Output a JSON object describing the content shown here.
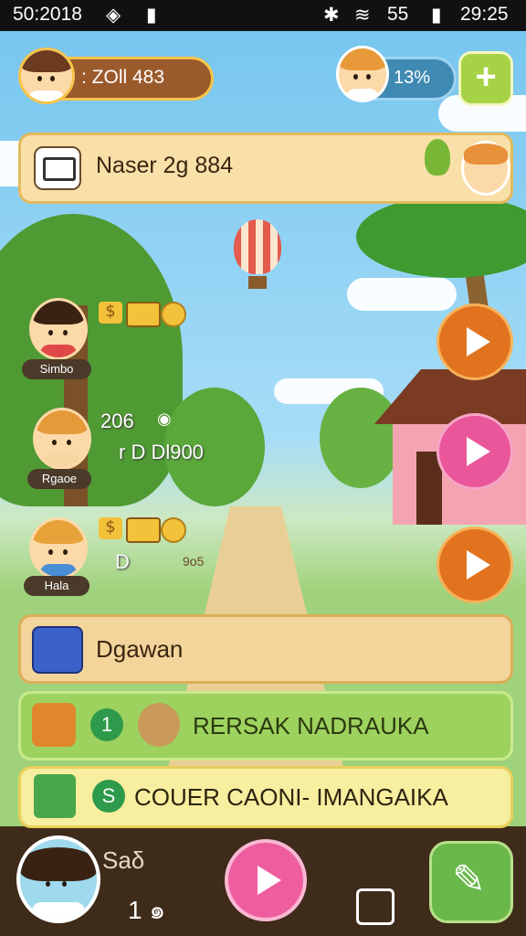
{
  "status_bar": {
    "time_left": "50:2018",
    "signal": "55",
    "time_right": "29:25"
  },
  "hud": {
    "currency_value": ": ZOll 483",
    "percent": "13%",
    "add_label": "+",
    "banner_text": "Naser 2g 884"
  },
  "characters": [
    {
      "name": "Simbo",
      "stat_main": "",
      "stat_sub": ""
    },
    {
      "name": "Rgaoe",
      "stat_main": "206",
      "stat_sub": "r D Dl900"
    },
    {
      "name": "Hala",
      "stat_main": "D",
      "stat_sub": "9o5"
    }
  ],
  "menu": {
    "item1": "Dgawan",
    "item2_badge": "1",
    "item2": "RERSAK NADRAUKA",
    "item3_badge": "S",
    "item3": "COUER CAONI- IMANGAIKA"
  },
  "bottom_bar": {
    "label": "Saδ",
    "icon_left_text": "1 ๑",
    "icon_right_text": ""
  },
  "colors": {
    "accent_orange": "#e2731e",
    "accent_pink": "#e9579a",
    "green": "#7dc24a",
    "cream": "#f6dfa4"
  }
}
